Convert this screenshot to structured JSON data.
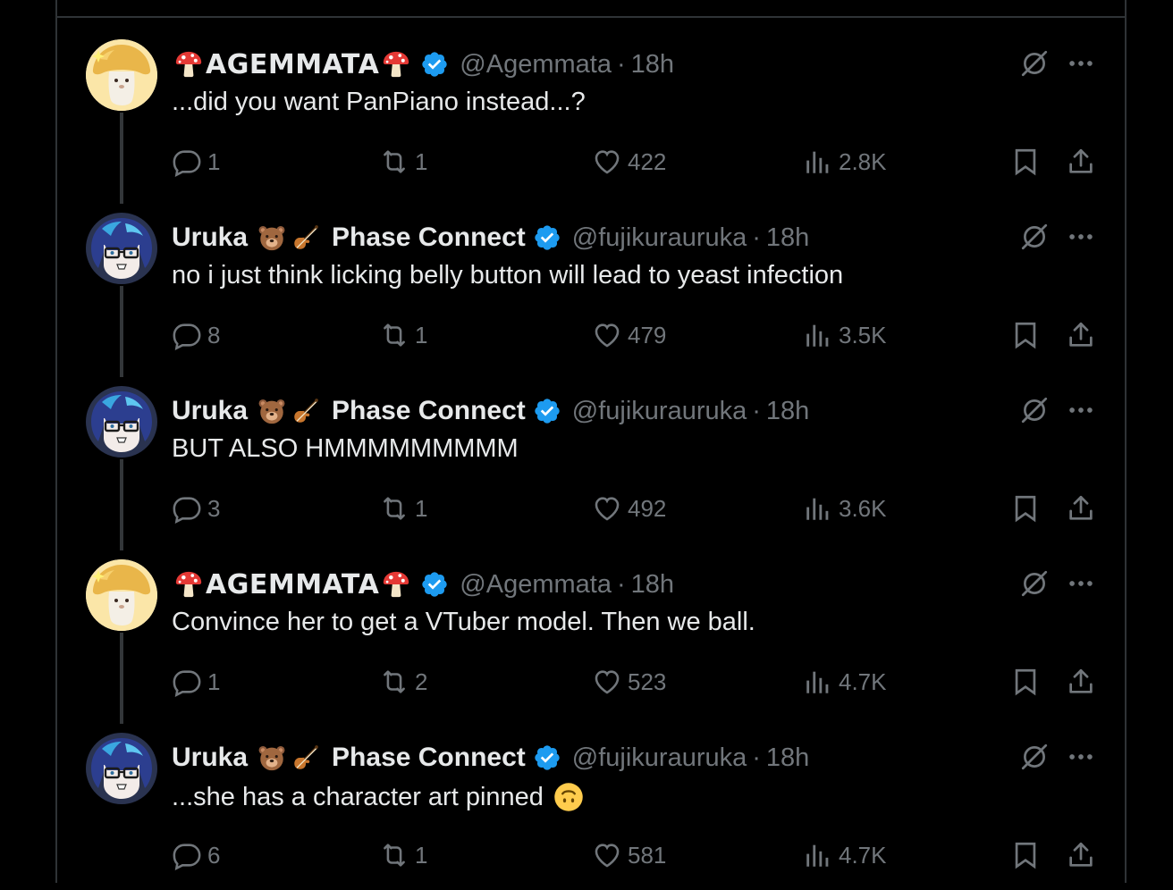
{
  "tweets": [
    {
      "name": "AGEMMATA",
      "name_style": "display",
      "name_emoji_before": "mushroom-icon",
      "name_emoji_after": "mushroom-icon",
      "handle": "@Agemmata",
      "time": "18h",
      "text": "...did you want PanPiano instead...?",
      "replies": "1",
      "retweets": "1",
      "likes": "422",
      "views": "2.8K",
      "avatar": "mushroom-avatar"
    },
    {
      "name": "Uruka",
      "name_suffix": "Phase Connect",
      "name_emojis": [
        "bear-face-icon",
        "violin-icon"
      ],
      "handle": "@fujikurauruka",
      "time": "18h",
      "text": "no i just think licking belly button will lead to yeast infection",
      "replies": "8",
      "retweets": "1",
      "likes": "479",
      "views": "3.5K",
      "avatar": "uruka-avatar"
    },
    {
      "name": "Uruka",
      "name_suffix": "Phase Connect",
      "name_emojis": [
        "bear-face-icon",
        "violin-icon"
      ],
      "handle": "@fujikurauruka",
      "time": "18h",
      "text": "BUT ALSO HMMMMMMMMM",
      "replies": "3",
      "retweets": "1",
      "likes": "492",
      "views": "3.6K",
      "avatar": "uruka-avatar"
    },
    {
      "name": "AGEMMATA",
      "name_style": "display",
      "name_emoji_before": "mushroom-icon",
      "name_emoji_after": "mushroom-icon",
      "handle": "@Agemmata",
      "time": "18h",
      "text": "Convince her to get a VTuber model. Then we ball.",
      "replies": "1",
      "retweets": "2",
      "likes": "523",
      "views": "4.7K",
      "avatar": "mushroom-avatar"
    },
    {
      "name": "Uruka",
      "name_suffix": "Phase Connect",
      "name_emojis": [
        "bear-face-icon",
        "violin-icon"
      ],
      "handle": "@fujikurauruka",
      "time": "18h",
      "text": "...she has a character art pinned",
      "text_emoji": "upside-down-face-icon",
      "replies": "6",
      "retweets": "1",
      "likes": "581",
      "views": "4.7K",
      "avatar": "uruka-avatar"
    }
  ],
  "separator": "·",
  "colors": {
    "background": "#000000",
    "text": "#e7e9ea",
    "muted": "#71767b",
    "border": "#2f3336",
    "verified": "#1d9bf0"
  }
}
